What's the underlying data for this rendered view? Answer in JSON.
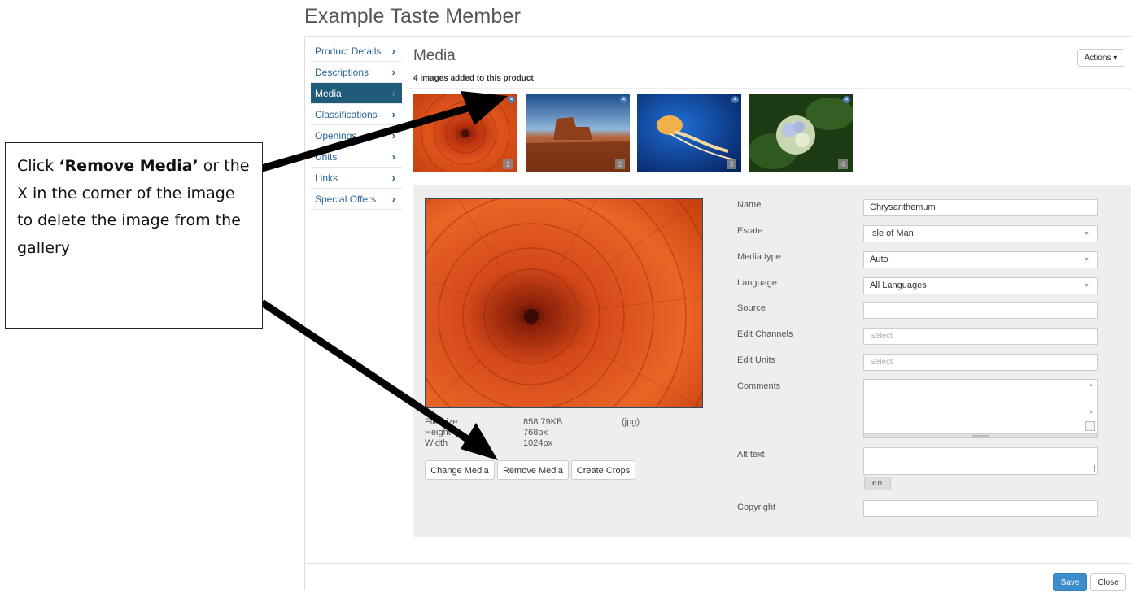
{
  "app": {
    "title": "Example Taste Member"
  },
  "sidebar": {
    "items": [
      {
        "label": "Product Details",
        "active": false
      },
      {
        "label": "Descriptions",
        "active": false
      },
      {
        "label": "Media",
        "active": true
      },
      {
        "label": "Classifications",
        "active": false
      },
      {
        "label": "Openings",
        "active": false
      },
      {
        "label": "Units",
        "active": false
      },
      {
        "label": "Links",
        "active": false
      },
      {
        "label": "Special Offers",
        "active": false
      }
    ]
  },
  "media": {
    "heading": "Media",
    "count_text": "4 images added to this product",
    "actions_label": "Actions ▾",
    "thumbnails": [
      {
        "number": "1",
        "subject": "chrysanthemum"
      },
      {
        "number": "2",
        "subject": "desert"
      },
      {
        "number": "3",
        "subject": "jellyfish"
      },
      {
        "number": "4",
        "subject": "hydrangeas"
      }
    ]
  },
  "details": {
    "filesize_label": "File size",
    "filesize_value": "858.79KB",
    "file_type": "(jpg)",
    "height_label": "Height",
    "height_value": "768px",
    "width_label": "Width",
    "width_value": "1024px",
    "change_media": "Change Media",
    "remove_media": "Remove Media",
    "create_crops": "Create Crops"
  },
  "form": {
    "name_label": "Name",
    "name_value": "Chrysanthemum",
    "estate_label": "Estate",
    "estate_value": "Isle of Man",
    "mediatype_label": "Media type",
    "mediatype_value": "Auto",
    "language_label": "Language",
    "language_value": "All Languages",
    "source_label": "Source",
    "source_value": "",
    "editchannels_label": "Edit Channels",
    "editchannels_placeholder": "Select",
    "editunits_label": "Edit Units",
    "editunits_placeholder": "Select",
    "comments_label": "Comments",
    "alttext_label": "Alt text",
    "lang_button": "en",
    "copyright_label": "Copyright",
    "copyright_value": ""
  },
  "footer": {
    "save": "Save",
    "close": "Close"
  },
  "callout": {
    "prefix": "Click ",
    "emphasis": "‘Remove Media’",
    "suffix": " or the X in the corner of the image to delete the image from the gallery"
  },
  "colors": {
    "accent": "#215b7a",
    "link": "#2a6496",
    "primary": "#3c8dcc",
    "arrow": "#000000"
  }
}
